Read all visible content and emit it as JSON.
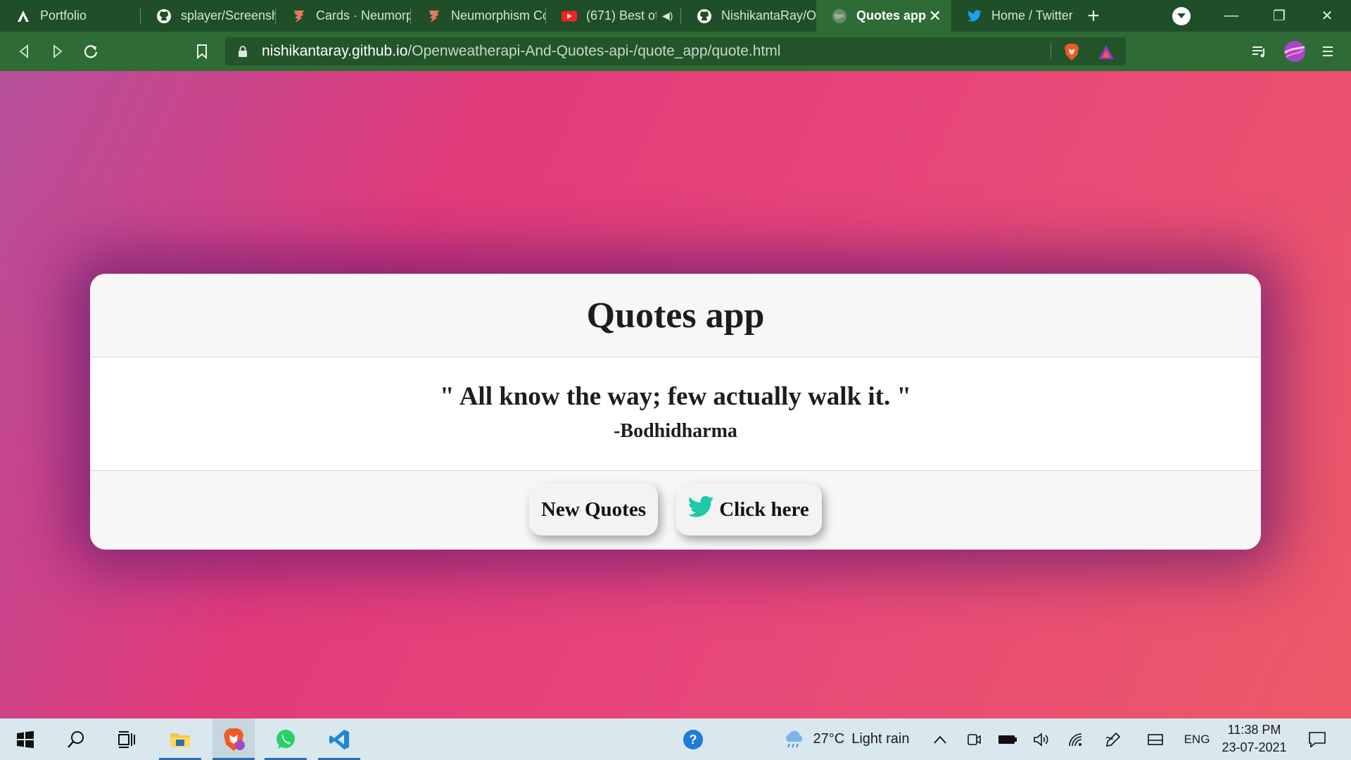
{
  "browser": {
    "tabs": [
      {
        "title": "Portfolio",
        "icon": "arc-logo-icon",
        "active": false
      },
      {
        "title": "splayer/Screensh",
        "icon": "github-icon",
        "active": false
      },
      {
        "title": "Cards · Neumorp",
        "icon": "codepen-icon",
        "active": false
      },
      {
        "title": "Neumorphism Cc",
        "icon": "codepen-icon",
        "active": false
      },
      {
        "title": "(671) Best of",
        "icon": "youtube-icon",
        "active": false,
        "audio": true
      },
      {
        "title": "NishikantaRay/O",
        "icon": "github-icon",
        "active": false
      },
      {
        "title": "Quotes app",
        "icon": "globe-icon",
        "active": true
      },
      {
        "title": "Home / Twitter",
        "icon": "twitter-icon",
        "active": false
      }
    ],
    "url": {
      "host": "nishikantaray.github.io",
      "path": "/Openweatherapi-And-Quotes-api-/quote_app/quote.html"
    }
  },
  "page": {
    "title": "Quotes app",
    "quote": "\" All know the way; few actually walk it. \"",
    "author": "-Bodhidharma",
    "buttons": {
      "new_quote": "New Quotes",
      "tweet": "Click here"
    },
    "colors": {
      "gradient_start": "#b54f9a",
      "gradient_mid": "#e13b7a",
      "gradient_end": "#ec5a68",
      "twitter_bird": "#1fc8a6"
    }
  },
  "taskbar": {
    "weather": {
      "temp": "27°C",
      "condition": "Light rain"
    },
    "language": "ENG",
    "time": "11:38 PM",
    "date": "23-07-2021"
  }
}
